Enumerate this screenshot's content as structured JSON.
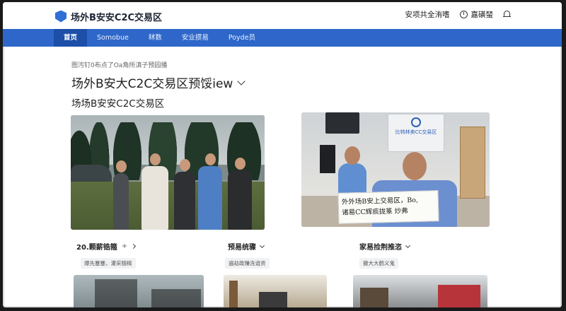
{
  "header": {
    "logo_text": "场外B安安C2C交易区",
    "security_link": "安项共全洧嗜",
    "user_name": "嘉磺蝅",
    "icons": [
      "clock-icon",
      "bell-icon",
      "shield-logo-icon"
    ]
  },
  "nav": {
    "items": [
      {
        "label": "首页",
        "active": true
      },
      {
        "label": "Somobue",
        "active": false
      },
      {
        "label": "秫数",
        "active": false
      },
      {
        "label": "安业掼易",
        "active": false
      },
      {
        "label": "Poyde员",
        "active": false
      }
    ]
  },
  "main": {
    "breadcrumb": "图汚钉0布点了Oa角所滇子预园播",
    "title": "场外B安大C2C交易区预馁iew",
    "subtitle": "场场B安安C2C交易区"
  },
  "photo2": {
    "wall_sign_line": "比特林卖CC交易区",
    "paper_line1": "外外场B安上交易区，Bo,",
    "paper_line2": "诸易CC辉痰拢篆 炒弗"
  },
  "categories": [
    {
      "label": "20.颗薪锆箍",
      "tag": "爆先蹇蹇，灌采随槁",
      "extra": "+"
    },
    {
      "label": "预易统骤",
      "tag": "遍劫政赚洗谙资"
    },
    {
      "label": "家易捡荆推恣",
      "tag": "撤大大鹤义鬼"
    }
  ]
}
